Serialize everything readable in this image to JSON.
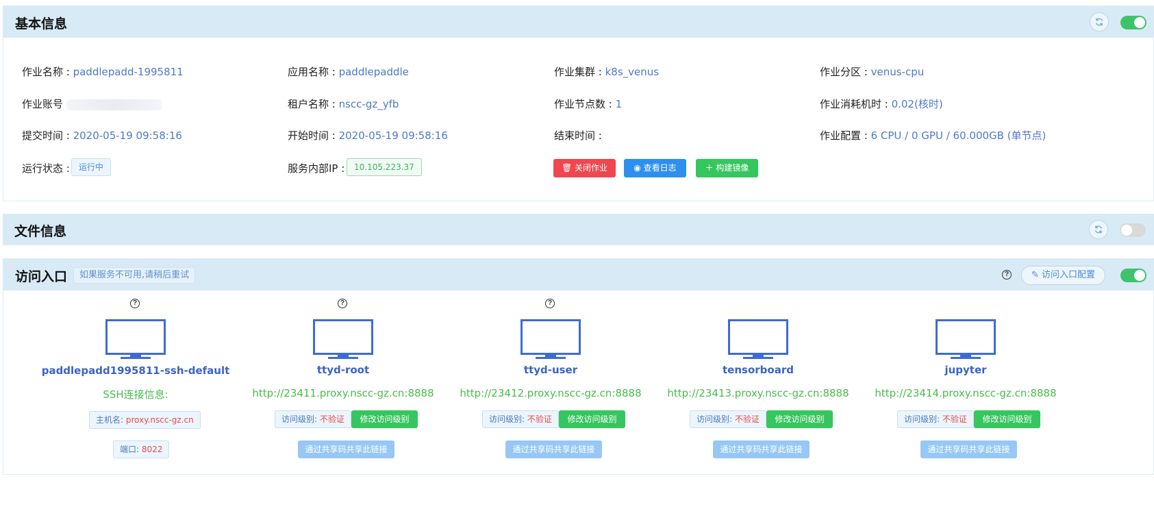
{
  "basic": {
    "title": "基本信息",
    "fields": [
      {
        "label": "作业名称 : ",
        "value": "paddlepadd-1995811"
      },
      {
        "label": "应用名称 : ",
        "value": "paddlepaddle"
      },
      {
        "label": "作业集群 : ",
        "value": "k8s_venus"
      },
      {
        "label": "作业分区 : ",
        "value": "venus-cpu"
      },
      {
        "label": "作业账号",
        "value": ""
      },
      {
        "label": "租户名称 : ",
        "value": "nscc-gz_yfb"
      },
      {
        "label": "作业节点数 : ",
        "value": "1"
      },
      {
        "label": "作业消耗机时 : ",
        "value": "0.02(核时)"
      },
      {
        "label": "提交时间 : ",
        "value": "2020-05-19 09:58:16"
      },
      {
        "label": "开始时间 : ",
        "value": "2020-05-19 09:58:16"
      },
      {
        "label": "结束时间 : ",
        "value": ""
      },
      {
        "label": "作业配置 : ",
        "value": "6 CPU / 0 GPU / 60.000GB (单节点)"
      },
      {
        "label": "运行状态 : ",
        "value": ""
      },
      {
        "label": "服务内部IP : ",
        "value": ""
      }
    ],
    "status_tag": "运行中",
    "ip_tag": "10.105.223.37",
    "buttons": {
      "close": "关闭作业",
      "log": "查看日志",
      "build": "构建镜像"
    },
    "toggle_on": true
  },
  "files": {
    "title": "文件信息",
    "toggle_on": false
  },
  "access": {
    "title": "访问入口",
    "hint": "如果服务不可用,请稍后重试",
    "config_button": "访问入口配置",
    "toggle_on": true,
    "entries": [
      {
        "name": "paddlepadd1995811-ssh-default",
        "url": "SSH连接信息:",
        "host_label": "主机名: ",
        "host": "proxy.nscc-gz.cn",
        "port_label": "端口: ",
        "port": "8022"
      },
      {
        "name": "ttyd-root",
        "url": "http://23411.proxy.nscc-gz.cn:8888",
        "level_label": "访问级别: ",
        "level": "不验证",
        "modify": "修改访问级别",
        "share": "通过共享码共享此链接"
      },
      {
        "name": "ttyd-user",
        "url": "http://23412.proxy.nscc-gz.cn:8888",
        "level_label": "访问级别: ",
        "level": "不验证",
        "modify": "修改访问级别",
        "share": "通过共享码共享此链接"
      },
      {
        "name": "tensorboard",
        "url": "http://23413.proxy.nscc-gz.cn:8888",
        "level_label": "访问级别: ",
        "level": "不验证",
        "modify": "修改访问级别",
        "share": "通过共享码共享此链接"
      },
      {
        "name": "jupyter",
        "url": "http://23414.proxy.nscc-gz.cn:8888",
        "level_label": "访问级别: ",
        "level": "不验证",
        "modify": "修改访问级别",
        "share": "通过共享码共享此链接"
      }
    ]
  },
  "colors": {
    "accent_blue": "#4f77c9",
    "success_green": "#36c65e",
    "danger_red": "#f04650",
    "header_bg": "#d8eaf5"
  }
}
